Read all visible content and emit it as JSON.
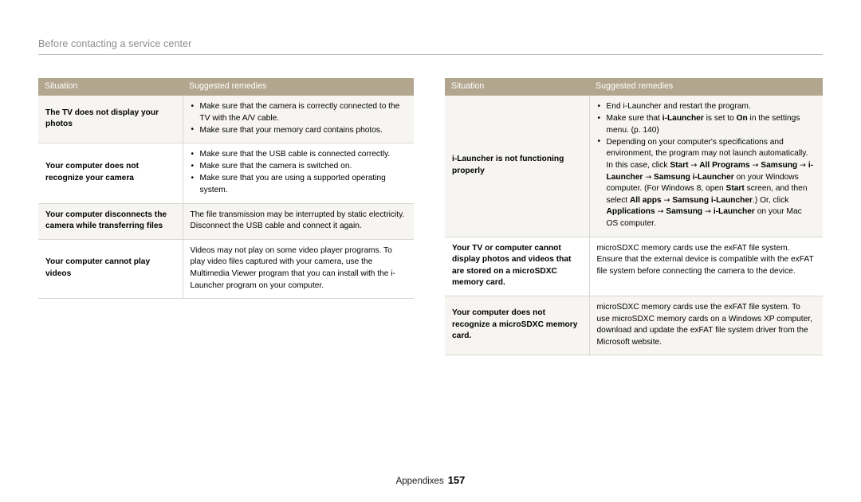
{
  "running_head": {
    "title": "Before contacting a service center"
  },
  "footer": {
    "label": "Appendixes",
    "page_number": "157"
  },
  "colors": {
    "table_header_bg": "#b3a68e",
    "table_header_text": "#ffffff",
    "row_shade_bg": "#f6f5f1",
    "row_plain_bg": "#ffffff",
    "rule": "#b9b9b9",
    "cell_border": "#d8d6d0",
    "running_head_text": "#8d8d8d"
  },
  "tables": {
    "left": {
      "columns": [
        "Situation",
        "Suggested remedies"
      ],
      "rows": [
        {
          "situation": "The TV does not display your photos",
          "remedy_type": "bullets",
          "remedies": [
            "Make sure that the camera is correctly connected to the TV with the A/V cable.",
            "Make sure that your memory card contains photos."
          ]
        },
        {
          "situation": "Your computer does not recognize your camera",
          "remedy_type": "bullets",
          "remedies": [
            "Make sure that the USB cable is connected correctly.",
            "Make sure that the camera is switched on.",
            "Make sure that you are using a supported operating system."
          ]
        },
        {
          "situation": "Your computer disconnects the camera while transferring files",
          "remedy_type": "paragraph",
          "remedies": [
            "The file transmission may be interrupted by static electricity. Disconnect the USB cable and connect it again."
          ]
        },
        {
          "situation": "Your computer cannot play videos",
          "remedy_type": "paragraph",
          "remedies": [
            "Videos may not play on some video player programs. To play video files captured with your camera, use the Multimedia Viewer program that you can install with the i-Launcher program on your computer."
          ]
        }
      ]
    },
    "right": {
      "columns": [
        "Situation",
        "Suggested remedies"
      ],
      "rows": [
        {
          "situation": "i-Launcher is not functioning properly",
          "remedy_type": "bullets",
          "remedies": [
            "End i-Launcher and restart the program.",
            "Make sure that i-Launcher is set to On in the settings menu. (p. 140)",
            "Depending on your computer's specifications and environment, the program may not launch automatically. In this case, click Start → All Programs → Samsung → i-Launcher → Samsung i-Launcher on your Windows computer. (For Windows 8, open Start screen, and then select All apps → Samsung i-Launcher.) Or, click Applications → Samsung → i-Launcher on your Mac OS computer."
          ]
        },
        {
          "situation": "Your TV or computer cannot display photos and videos that are stored on a microSDXC memory card.",
          "remedy_type": "paragraph",
          "remedies": [
            "microSDXC memory cards use the exFAT file system. Ensure that the external device is compatible with the exFAT file system before connecting the camera to the device."
          ]
        },
        {
          "situation": "Your computer does not recognize a microSDXC memory card.",
          "remedy_type": "paragraph",
          "remedies": [
            "microSDXC memory cards use the exFAT file system. To use microSDXC memory cards on a Windows XP computer, download and update the exFAT file system driver from the Microsoft website."
          ]
        }
      ]
    }
  }
}
